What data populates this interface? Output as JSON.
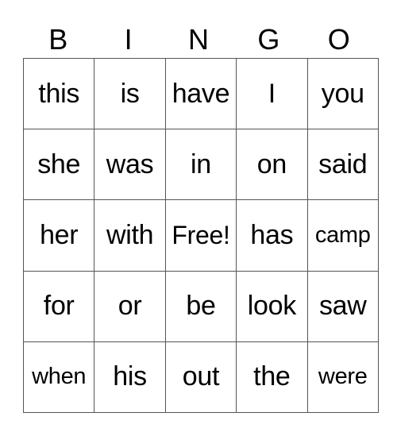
{
  "header": {
    "letters": [
      "B",
      "I",
      "N",
      "G",
      "O"
    ]
  },
  "grid": {
    "rows": [
      [
        "this",
        "is",
        "have",
        "I",
        "you"
      ],
      [
        "she",
        "was",
        "in",
        "on",
        "said"
      ],
      [
        "her",
        "with",
        "Free!",
        "has",
        "camp"
      ],
      [
        "for",
        "or",
        "be",
        "look",
        "saw"
      ],
      [
        "when",
        "his",
        "out",
        "the",
        "were"
      ]
    ]
  }
}
